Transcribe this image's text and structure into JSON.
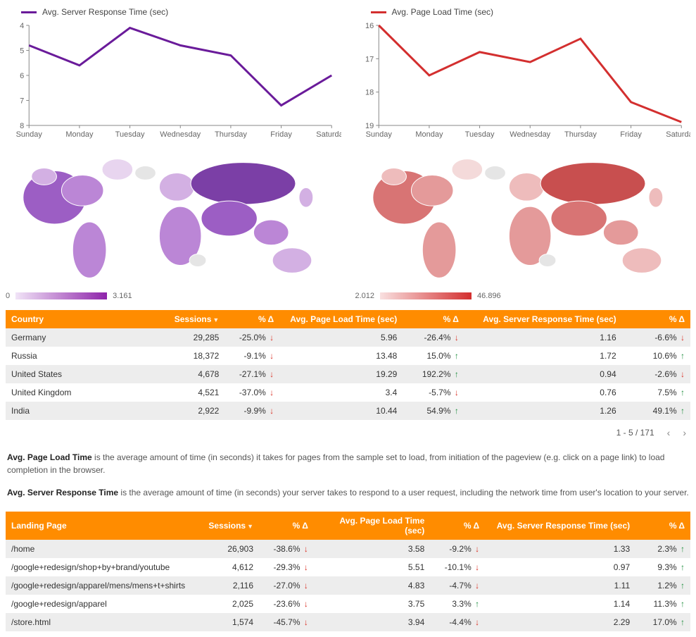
{
  "colors": {
    "accent": "#ff8c00",
    "server_line": "#6a1b9a",
    "page_line": "#d32f2f"
  },
  "chart_data": [
    {
      "type": "line",
      "title": "Avg. Server Response Time (sec)",
      "categories": [
        "Sunday",
        "Monday",
        "Tuesday",
        "Wednesday",
        "Thursday",
        "Friday",
        "Saturday"
      ],
      "values": [
        4.8,
        5.6,
        4.1,
        4.8,
        5.2,
        7.2,
        6.0
      ],
      "ylim": [
        8,
        4
      ],
      "yticks": [
        4,
        5,
        6,
        7,
        8
      ]
    },
    {
      "type": "line",
      "title": "Avg. Page Load Time (sec)",
      "categories": [
        "Sunday",
        "Monday",
        "Tuesday",
        "Wednesday",
        "Thursday",
        "Friday",
        "Saturday"
      ],
      "values": [
        16.0,
        17.5,
        16.8,
        17.1,
        16.4,
        18.3,
        18.9
      ],
      "ylim": [
        19,
        16
      ],
      "yticks": [
        16,
        17,
        18,
        19
      ]
    }
  ],
  "maps": {
    "left": {
      "min": "0",
      "max": "3.161",
      "hue": "purple"
    },
    "right": {
      "min": "2.012",
      "max": "46.896",
      "hue": "red"
    }
  },
  "country_table": {
    "headers": [
      "Country",
      "Sessions",
      "% Δ",
      "Avg. Page Load Time (sec)",
      "% Δ",
      "Avg. Server Response Time (sec)",
      "% Δ"
    ],
    "rows": [
      {
        "country": "Germany",
        "sessions": "29,285",
        "sess_d": "-25.0%",
        "sess_dir": "down",
        "plt": "5.96",
        "plt_d": "-26.4%",
        "plt_dir": "down",
        "srt": "1.16",
        "srt_d": "-6.6%",
        "srt_dir": "down"
      },
      {
        "country": "Russia",
        "sessions": "18,372",
        "sess_d": "-9.1%",
        "sess_dir": "down",
        "plt": "13.48",
        "plt_d": "15.0%",
        "plt_dir": "up",
        "srt": "1.72",
        "srt_d": "10.6%",
        "srt_dir": "up"
      },
      {
        "country": "United States",
        "sessions": "4,678",
        "sess_d": "-27.1%",
        "sess_dir": "down",
        "plt": "19.29",
        "plt_d": "192.2%",
        "plt_dir": "up",
        "srt": "0.94",
        "srt_d": "-2.6%",
        "srt_dir": "down"
      },
      {
        "country": "United Kingdom",
        "sessions": "4,521",
        "sess_d": "-37.0%",
        "sess_dir": "down",
        "plt": "3.4",
        "plt_d": "-5.7%",
        "plt_dir": "down",
        "srt": "0.76",
        "srt_d": "7.5%",
        "srt_dir": "up"
      },
      {
        "country": "India",
        "sessions": "2,922",
        "sess_d": "-9.9%",
        "sess_dir": "down",
        "plt": "10.44",
        "plt_d": "54.9%",
        "plt_dir": "up",
        "srt": "1.26",
        "srt_d": "49.1%",
        "srt_dir": "up"
      }
    ],
    "pager": {
      "range": "1 - 5 / 171"
    }
  },
  "descriptions": {
    "plt_term": "Avg. Page Load Time",
    "plt_text": " is the average amount of time (in seconds) it takes for pages from the sample set to load, from initiation of the pageview (e.g. click on a page link) to load completion in the browser.",
    "srt_term": "Avg. Server Response Time",
    "srt_text": " is the average amount of time (in seconds) your server takes to respond to a user request, including the network time from user's location to your server."
  },
  "landing_table": {
    "headers": [
      "Landing Page",
      "Sessions",
      "% Δ",
      "Avg. Page Load Time (sec)",
      "% Δ",
      "Avg. Server Response Time (sec)",
      "% Δ"
    ],
    "rows": [
      {
        "page": "/home",
        "sessions": "26,903",
        "sess_d": "-38.6%",
        "sess_dir": "down",
        "plt": "3.58",
        "plt_d": "-9.2%",
        "plt_dir": "down",
        "srt": "1.33",
        "srt_d": "2.3%",
        "srt_dir": "up"
      },
      {
        "page": "/google+redesign/shop+by+brand/youtube",
        "sessions": "4,612",
        "sess_d": "-29.3%",
        "sess_dir": "down",
        "plt": "5.51",
        "plt_d": "-10.1%",
        "plt_dir": "down",
        "srt": "0.97",
        "srt_d": "9.3%",
        "srt_dir": "up"
      },
      {
        "page": "/google+redesign/apparel/mens/mens+t+shirts",
        "sessions": "2,116",
        "sess_d": "-27.0%",
        "sess_dir": "down",
        "plt": "4.83",
        "plt_d": "-4.7%",
        "plt_dir": "down",
        "srt": "1.11",
        "srt_d": "1.2%",
        "srt_dir": "up"
      },
      {
        "page": "/google+redesign/apparel",
        "sessions": "2,025",
        "sess_d": "-23.6%",
        "sess_dir": "down",
        "plt": "3.75",
        "plt_d": "3.3%",
        "plt_dir": "up",
        "srt": "1.14",
        "srt_d": "11.3%",
        "srt_dir": "up"
      },
      {
        "page": "/store.html",
        "sessions": "1,574",
        "sess_d": "-45.7%",
        "sess_dir": "down",
        "plt": "3.94",
        "plt_d": "-4.4%",
        "plt_dir": "down",
        "srt": "2.29",
        "srt_d": "17.0%",
        "srt_dir": "up"
      }
    ]
  }
}
